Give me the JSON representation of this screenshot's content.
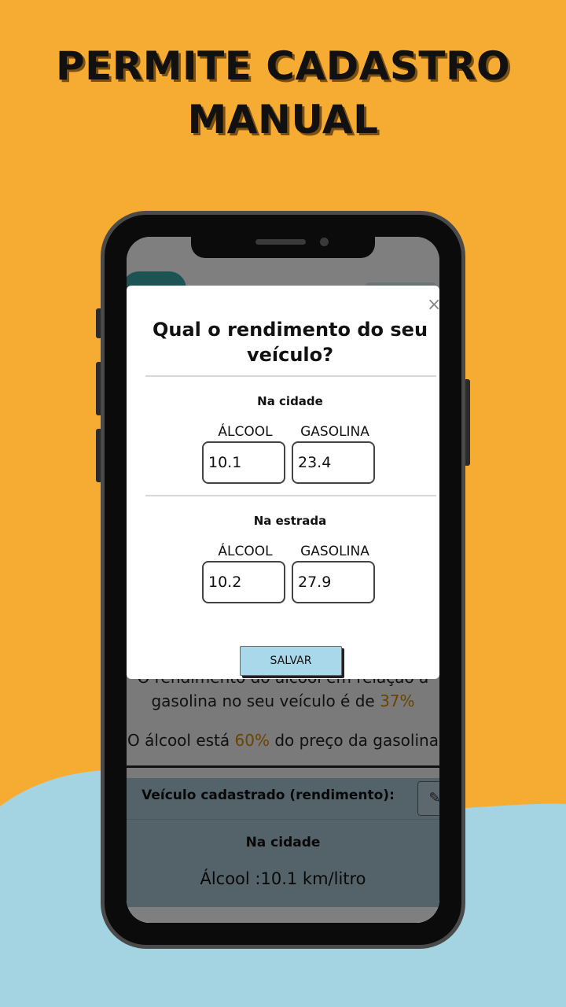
{
  "promo": {
    "headline_line1": "PERMITE CADASTRO",
    "headline_line2": "MANUAL"
  },
  "app": {
    "result_line1": "O rendimento do álcool em relação a",
    "result_line2_prefix": "gasolina no seu veículo é de ",
    "result_line2_pct": "37%",
    "result_line3_prefix": "O álcool está ",
    "result_line3_pct": "60%",
    "result_line3_suffix": " do preço da gasolina",
    "vehicle_panel": {
      "title": "Veículo cadastrado (rendimento):",
      "edit_icon": "pencil-icon",
      "subtitle": "Na cidade",
      "line": "Álcool :10.1 km/litro"
    }
  },
  "modal": {
    "close_glyph": "×",
    "title": "Qual o rendimento do seu veículo?",
    "city": {
      "label": "Na cidade",
      "alcohol_label": "ÁLCOOL",
      "gasoline_label": "GASOLINA",
      "alcohol_value": "10.1",
      "gasoline_value": "23.4"
    },
    "road": {
      "label": "Na estrada",
      "alcohol_label": "ÁLCOOL",
      "gasoline_label": "GASOLINA",
      "alcohol_value": "10.2",
      "gasoline_value": "27.9"
    },
    "save_label": "SALVAR"
  },
  "colors": {
    "background": "#f6ac33",
    "wave": "#a4d4e2",
    "highlight": "#d08a00",
    "save_button": "#a9d8ea"
  }
}
